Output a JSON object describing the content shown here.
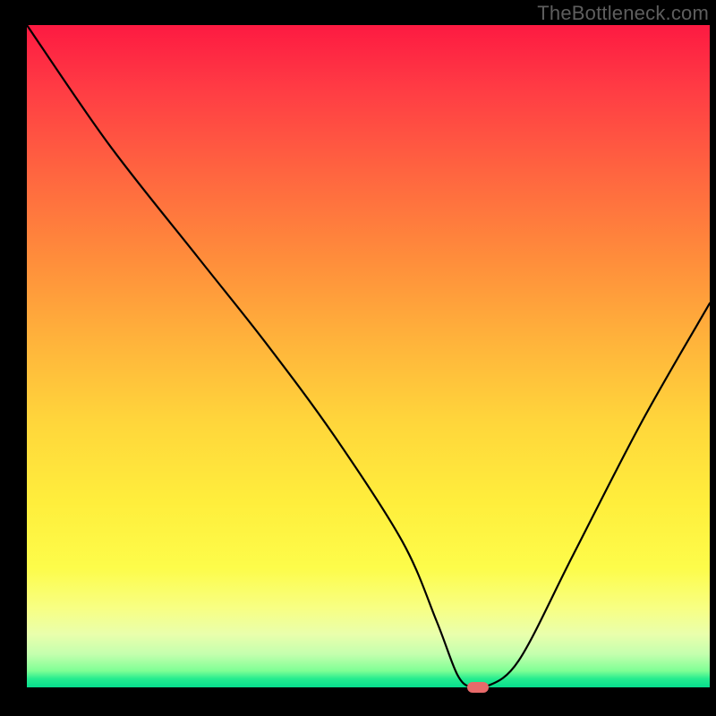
{
  "watermark": "TheBottleneck.com",
  "chart_data": {
    "type": "line",
    "title": "",
    "xlabel": "",
    "ylabel": "",
    "xlim": [
      0,
      100
    ],
    "ylim": [
      0,
      100
    ],
    "grid": false,
    "legend": false,
    "background_gradient": {
      "top": "#fd1a42",
      "bottom": "#06dd8e"
    },
    "x": [
      0,
      12,
      25,
      35,
      45,
      55,
      60,
      63,
      65,
      67,
      72,
      80,
      90,
      100
    ],
    "values": [
      100,
      82,
      65,
      52,
      38,
      22,
      10,
      2,
      0,
      0,
      4,
      20,
      40,
      58
    ],
    "marker": {
      "x": 66,
      "y": 0,
      "color": "#e86a6a",
      "shape": "pill"
    }
  },
  "colors": {
    "background": "#000000",
    "watermark_text": "#5e5e5e",
    "curve": "#000000"
  }
}
